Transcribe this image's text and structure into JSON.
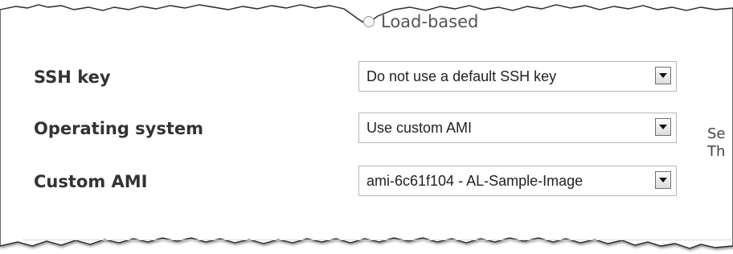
{
  "layout_mode": {
    "option_label": "Load-based"
  },
  "fields": [
    {
      "label": "SSH key",
      "value": "Do not use a default SSH key"
    },
    {
      "label": "Operating system",
      "value": "Use custom AMI"
    },
    {
      "label": "Custom AMI",
      "value": "ami-6c61f104 - AL-Sample-Image"
    }
  ],
  "side_note": {
    "line1": "Se",
    "line2": "Th"
  }
}
